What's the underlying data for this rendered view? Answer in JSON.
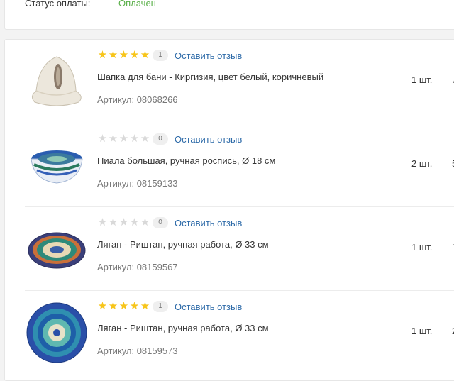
{
  "payment": {
    "label": "Статус оплаты:",
    "value": "Оплачен"
  },
  "items": [
    {
      "rating": 5,
      "reviews": "1",
      "review_link": "Оставить отзыв",
      "title": "Шапка для бани - Киргизия, цвет белый, коричневый",
      "sku": "Артикул: 08068266",
      "qty": "1 шт.",
      "price_partial": "7"
    },
    {
      "rating": 0,
      "reviews": "0",
      "review_link": "Оставить отзыв",
      "title": "Пиала большая, ручная роспись, Ø 18 см",
      "sku": "Артикул: 08159133",
      "qty": "2 шт.",
      "price_partial": "5"
    },
    {
      "rating": 0,
      "reviews": "0",
      "review_link": "Оставить отзыв",
      "title": "Ляган - Риштан, ручная работа, Ø 33 см",
      "sku": "Артикул: 08159567",
      "qty": "1 шт.",
      "price_partial": "1"
    },
    {
      "rating": 5,
      "reviews": "1",
      "review_link": "Оставить отзыв",
      "title": "Ляган - Риштан, ручная работа, Ø 33 см",
      "sku": "Артикул: 08159573",
      "qty": "1 шт.",
      "price_partial": "2"
    }
  ],
  "colors": {
    "star_on": "#f7c51a",
    "star_off": "#d9d9d9",
    "link": "#2d6aa8",
    "paid": "#5bb04a"
  }
}
